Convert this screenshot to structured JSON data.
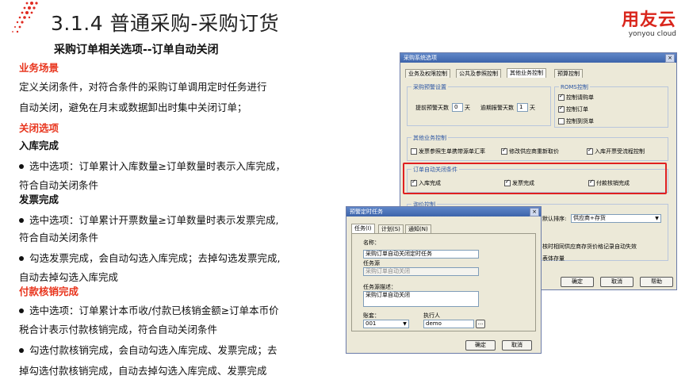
{
  "header": {
    "title": "3.1.4 普通采购-采购订货",
    "subtitle": "采购订单相关选项--订单自动关闭",
    "brand_cn": "用友云",
    "brand_en": "yonyou cloud"
  },
  "left": {
    "lines": [
      "业务场景",
      "定义关闭条件，对符合条件的采购订单调用定时任务进行",
      "自动关闭，避免在月末或数据卸出时集中关闭订单；",
      "关闭选项",
      "入库完成",
      "选中选项：订单累计入库数量≥订单数量时表示入库完成，",
      "符合自动关闭条件",
      "发票完成",
      "选中选项：订单累计开票数量≥订单数量时表示发票完成,",
      "符合自动关闭条件",
      "勾选发票完成，会自动勾选入库完成；去掉勾选发票完成,",
      "自动去掉勾选入库完成",
      "付款核销完成",
      "选中选项：订单累计本币收/付款已核销金额≥订单本币价",
      "税合计表示付款核销完成，符合自动关闭条件",
      "勾选付款核销完成，会自动勾选入库完成、发票完成；去",
      "掉勾选付款核销完成，自动去掉勾选入库完成、发票完成"
    ]
  },
  "sysdlg": {
    "title": "采购系统选项",
    "close": "×",
    "tabs": [
      "业务及权限控制",
      "公共及参照控制",
      "其他业务控制",
      "预算控制"
    ],
    "grp_warn": "采购预警设置",
    "advance_warn_label": "提前预警天数",
    "advance_warn_value": "0",
    "overdue_warn_label": "逾期报警天数",
    "overdue_warn_value": "1",
    "day_unit": "天",
    "grp_roms": "ROMS控制",
    "roms_items": [
      "控制请购单",
      "控制订单",
      "控制到货单"
    ],
    "grp_other": "其他业务控制",
    "other_items": [
      "发票参照生单携带源单汇率",
      "修改供应商重新取价",
      "入库开票受流程控制"
    ],
    "grp_close": "订单自动关闭条件",
    "close_items": [
      "入库完成",
      "发票完成",
      "付款核销完成"
    ],
    "grp_hidden": "询价控制",
    "sort_label": "默认排序:",
    "sort_value": "供应商+存货",
    "partial_1": "核时相同供应商存货价格记录自动失效",
    "partial_2": "表体存量",
    "ok": "确定",
    "cancel": "取消",
    "help": "帮助"
  },
  "taskdlg": {
    "title": "预警定时任务",
    "close": "×",
    "tabs": [
      "任务(I)",
      "计划(S)",
      "通知(N)"
    ],
    "name_label": "名称：",
    "name_value": "采购订单自动关闭定时任务",
    "source_label": "任务源",
    "source_value": "采购订单自动关闭",
    "desc_label": "任务源描述：",
    "desc_value": "采购订单自动关闭",
    "account_label": "账套：",
    "account_value": "001",
    "executor_label": "执行人",
    "executor_value": "demo",
    "browse": "...",
    "ok": "确定",
    "cancel": "取消"
  },
  "colors": {
    "accent_red": "#e8341c",
    "brand_red": "#d9261c",
    "highlight": "#e02020"
  }
}
